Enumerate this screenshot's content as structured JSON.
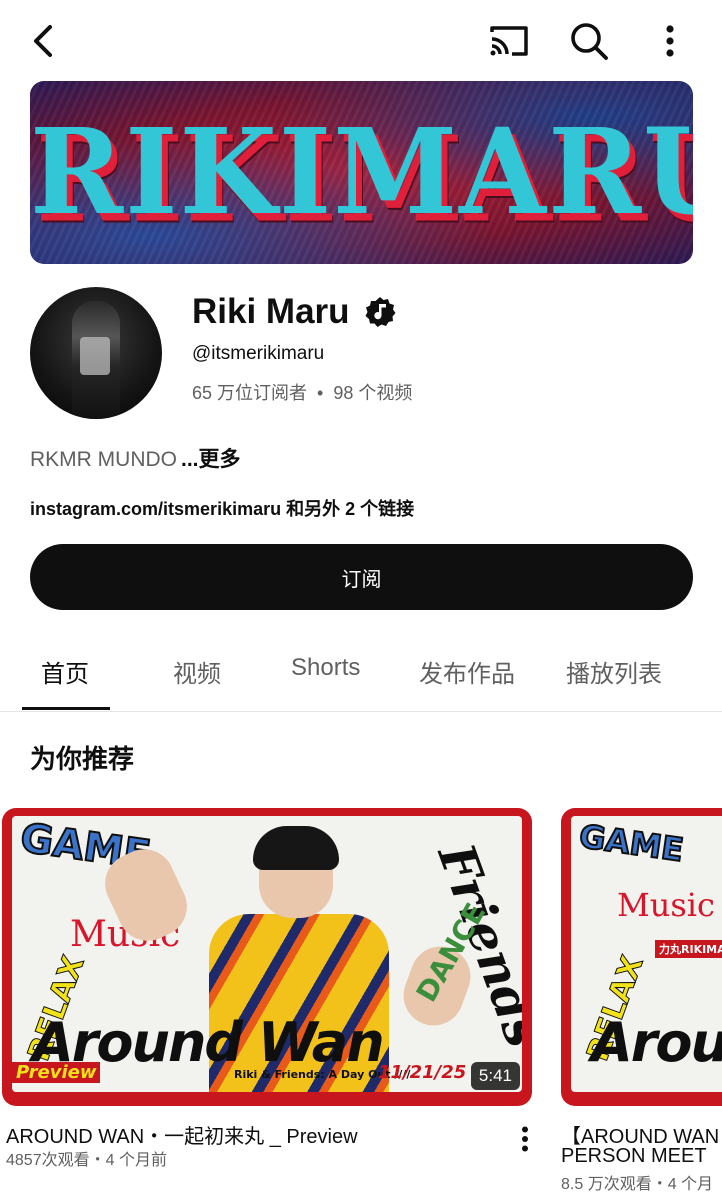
{
  "channel": {
    "banner_text": "RIKIMARU",
    "name": "Riki Maru",
    "handle": "@itsmerikimaru",
    "subscribers": "65 万位订阅者",
    "stats_separator": "•",
    "video_count": "98 个视频",
    "description": "RKMR MUNDO",
    "more_label": "...更多",
    "link_main": "instagram.com/itsmerikimaru",
    "link_extra": " 和另外 2 个链接",
    "subscribe_label": "订阅"
  },
  "tabs": [
    {
      "label": "首页",
      "active": true
    },
    {
      "label": "视频",
      "active": false
    },
    {
      "label": "Shorts",
      "active": false
    },
    {
      "label": "发布作品",
      "active": false
    },
    {
      "label": "播放列表",
      "active": false
    }
  ],
  "section": {
    "title": "为你推荐"
  },
  "videos": [
    {
      "title": "AROUND WAN・一起初来丸 _ Preview",
      "meta": "4857次观看・4 个月前",
      "duration": "5:41",
      "thumb_text": {
        "game": "GAME",
        "music": "Music",
        "relax": "RELAX",
        "around": "Around Wan",
        "friends": "Friends",
        "dance": "DANCE",
        "preview": "Preview",
        "footer": "Riki & Friends: A Day Out ////",
        "date": "11/21/25"
      }
    },
    {
      "title": "【AROUND WAN",
      "title_line2": "PERSON MEET",
      "meta": "8.5 万次观看・4 个月",
      "thumb_text": {
        "game": "GAME",
        "music": "Music",
        "relax": "RELAX",
        "around": "Around Wan",
        "label": "力丸RIKIMARU"
      }
    }
  ],
  "icons": {
    "back": "back-arrow-icon",
    "cast": "cast-icon",
    "search": "search-icon",
    "more": "more-vertical-icon",
    "verified": "verified-music-icon"
  }
}
